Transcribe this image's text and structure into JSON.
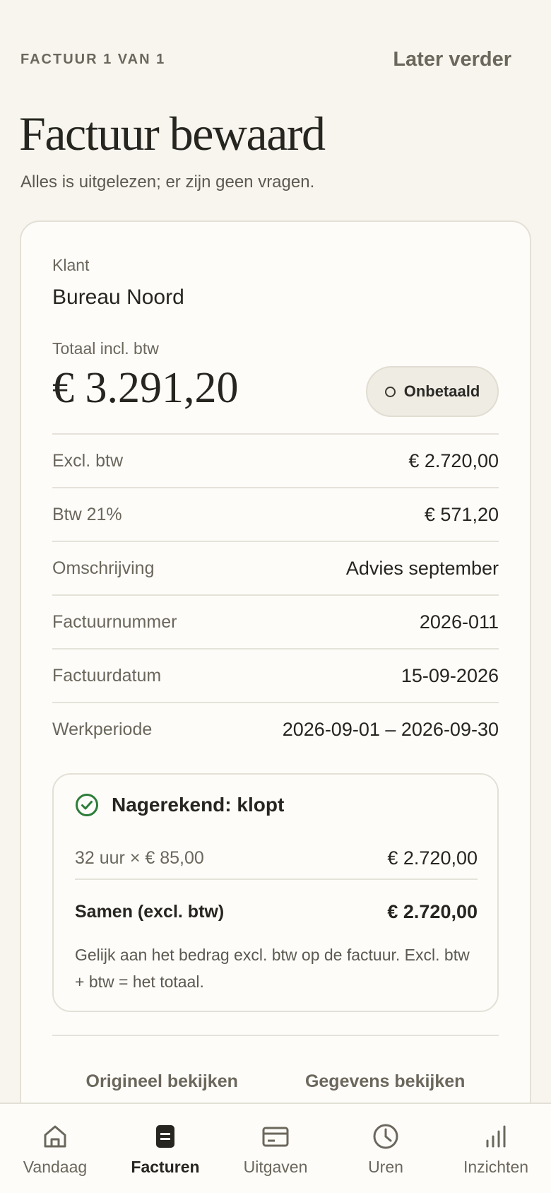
{
  "header": {
    "step_label": "FACTUUR 1 VAN 1",
    "later_label": "Later verder"
  },
  "page": {
    "title": "Factuur bewaard",
    "subtitle": "Alles is uitgelezen; er zijn geen vragen."
  },
  "invoice": {
    "client_label": "Klant",
    "client_name": "Bureau Noord",
    "total_label": "Totaal incl. btw",
    "total_amount": "€ 3.291,20",
    "status": "Onbetaald",
    "rows": [
      {
        "label": "Excl. btw",
        "value": "€ 2.720,00"
      },
      {
        "label": "Btw 21%",
        "value": "€ 571,20"
      },
      {
        "label": "Omschrijving",
        "value": "Advies september"
      },
      {
        "label": "Factuurnummer",
        "value": "2026-011"
      },
      {
        "label": "Factuurdatum",
        "value": "15-09-2026"
      },
      {
        "label": "Werkperiode",
        "value": "2026-09-01 – 2026-09-30"
      }
    ]
  },
  "check": {
    "title": "Nagerekend: klopt",
    "calc_label": "32 uur × € 85,00",
    "calc_value": "€ 2.720,00",
    "sum_label": "Samen (excl. btw)",
    "sum_value": "€ 2.720,00",
    "note": "Gelijk aan het bedrag excl. btw op de factuur. Excl. btw + btw = het totaal."
  },
  "actions": {
    "view_original": "Origineel bekijken",
    "view_details": "Gegevens bekijken"
  },
  "tabs": [
    {
      "label": "Vandaag",
      "icon": "home-icon",
      "active": false
    },
    {
      "label": "Facturen",
      "icon": "invoice-icon",
      "active": true
    },
    {
      "label": "Uitgaven",
      "icon": "card-icon",
      "active": false
    },
    {
      "label": "Uren",
      "icon": "clock-icon",
      "active": false
    },
    {
      "label": "Inzichten",
      "icon": "bar-chart-icon",
      "active": false
    }
  ],
  "colors": {
    "background": "#f7f5ee",
    "card": "#fdfcf9",
    "success": "#2e7d3a",
    "text": "#26251f",
    "muted": "#6b675c"
  }
}
